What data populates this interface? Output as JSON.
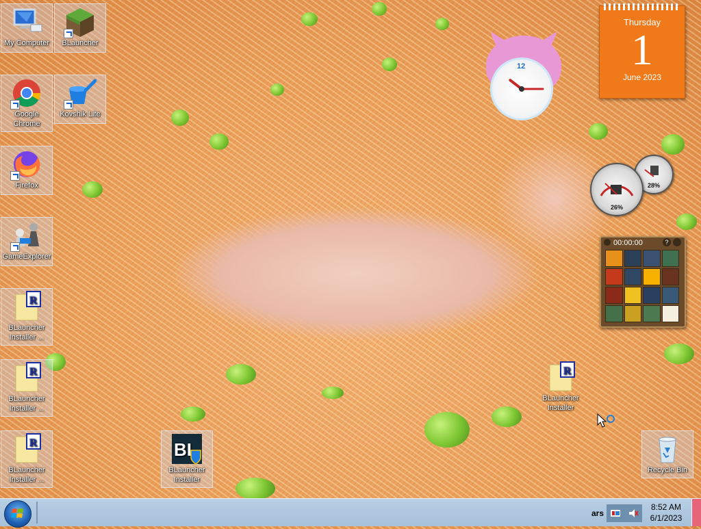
{
  "desktop": {
    "icons": [
      {
        "label": "My Computer",
        "kind": "computer"
      },
      {
        "label": "BLauncher",
        "kind": "grass-block",
        "shortcut": true
      },
      {
        "label": "Google Chrome",
        "kind": "chrome",
        "shortcut": true
      },
      {
        "label": "Kovshik Lite",
        "kind": "bucket",
        "shortcut": true
      },
      {
        "label": "Firefox",
        "kind": "firefox",
        "shortcut": true
      },
      {
        "label": "GameExplorer",
        "kind": "chess",
        "shortcut": true
      },
      {
        "label": "BLauncher Installer ...",
        "kind": "installer-file"
      },
      {
        "label": "BLauncher Installer ...",
        "kind": "installer-file"
      },
      {
        "label": "BLauncher Installer ...",
        "kind": "installer-file"
      },
      {
        "label": "BLauncher Installer",
        "kind": "bl-shield"
      },
      {
        "label": "BLauncher Installer",
        "kind": "installer-file"
      },
      {
        "label": "Recycle Bin",
        "kind": "recycle-bin"
      }
    ]
  },
  "calendar": {
    "weekday": "Thursday",
    "day": "1",
    "month_year": "June 2023"
  },
  "clock_gadget": {
    "numeral": "12",
    "hour": 10,
    "minute": 15
  },
  "meters": {
    "cpu_percent": "26%",
    "ram_percent": "28%"
  },
  "puzzle": {
    "timer": "00:00:00",
    "help": "?",
    "tiles": [
      "#e8901a",
      "#2c3f58",
      "#3a5270",
      "#3f7050",
      "#c63a1c",
      "#2e4866",
      "#f5b000",
      "#6a3320",
      "#8a2a18",
      "#f0c020",
      "#2a4060",
      "#385878",
      "#44704a",
      "#caa020",
      "#4c7a50",
      "#f5efe0"
    ]
  },
  "taskbar": {
    "time": "8:52 AM",
    "date": "6/1/2023",
    "lang": "ars",
    "colors": {
      "bar": "#a9c3db",
      "start": "#1d5fb4"
    }
  }
}
